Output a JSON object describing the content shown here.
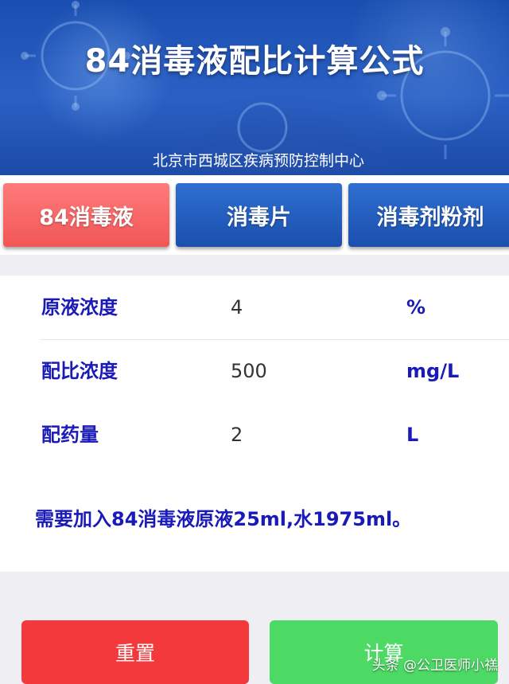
{
  "banner": {
    "title": "84消毒液配比计算公式",
    "subtitle": "北京市西城区疾病预防控制中心"
  },
  "tabs": [
    {
      "label": "84消毒液",
      "active": true
    },
    {
      "label": "消毒片",
      "active": false
    },
    {
      "label": "消毒剂粉剂",
      "active": false
    }
  ],
  "form": {
    "rows": [
      {
        "label": "原液浓度",
        "value": "4",
        "unit": "%"
      },
      {
        "label": "配比浓度",
        "value": "500",
        "unit": "mg/L"
      },
      {
        "label": "配药量",
        "value": "2",
        "unit": "L"
      }
    ],
    "result": "需要加入84消毒液原液25ml,水1975ml。"
  },
  "buttons": {
    "reset_label": "重置",
    "calculate_label": "计算"
  },
  "watermark": "头条 @公卫医师小禚",
  "colors": {
    "banner_blue": "#1f55b8",
    "active_tab": "#f25656",
    "inactive_tab": "#1b4fae",
    "label_text": "#1a1ab8",
    "reset_button": "#f4393d",
    "calculate_button": "#4cd964"
  }
}
